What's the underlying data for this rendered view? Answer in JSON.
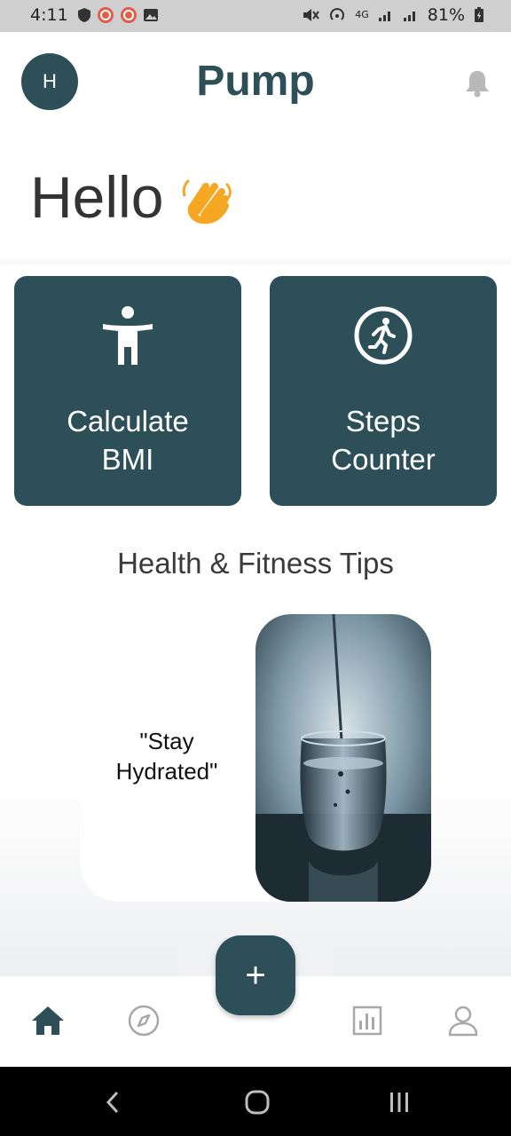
{
  "status_bar": {
    "time": "4:11",
    "battery_percent": "81%",
    "network": "4G"
  },
  "header": {
    "avatar_initial": "H",
    "app_title": "Pump",
    "bell_icon": "bell-icon"
  },
  "greeting": {
    "text": "Hello",
    "emoji": "waving-hand-icon"
  },
  "cards": [
    {
      "label_line1": "Calculate",
      "label_line2": "BMI",
      "icon": "person-arms-out-icon"
    },
    {
      "label_line1": "Steps",
      "label_line2": "Counter",
      "icon": "running-person-icon"
    }
  ],
  "tips": {
    "section_title": "Health & Fitness Tips",
    "tip_line1": "\"Stay",
    "tip_line2": "Hydrated\"",
    "image": "water-glass-image"
  },
  "bottom_nav": {
    "items": [
      "home-icon",
      "compass-icon",
      "add-icon",
      "stats-icon",
      "profile-icon"
    ],
    "fab_label": "+"
  },
  "colors": {
    "primary": "#2d4f57",
    "accent": "#f5a623",
    "text": "#333333"
  }
}
